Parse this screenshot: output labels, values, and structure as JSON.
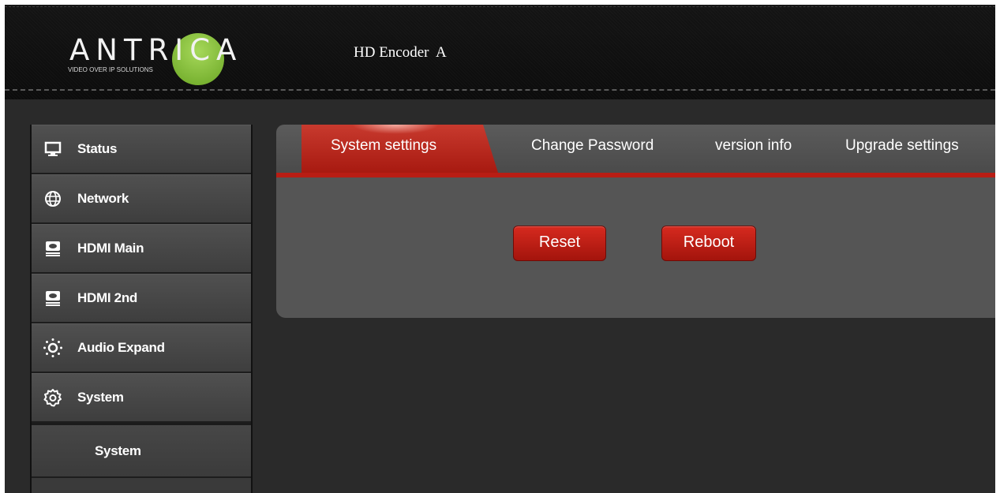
{
  "header": {
    "logo_text": "ANTRICA",
    "logo_tagline": "VIDEO OVER IP SOLUTIONS",
    "device_title": "HD Encoder  A"
  },
  "sidebar": {
    "items": [
      {
        "label": "Status",
        "icon": "monitor-icon"
      },
      {
        "label": "Network",
        "icon": "globe-icon"
      },
      {
        "label": "HDMI Main",
        "icon": "hdmi-icon"
      },
      {
        "label": "HDMI 2nd",
        "icon": "hdmi-icon"
      },
      {
        "label": "Audio Expand",
        "icon": "audio-dots-icon"
      },
      {
        "label": "System",
        "icon": "gear-icon"
      }
    ],
    "subitem": {
      "label": "System"
    }
  },
  "tabs": [
    {
      "label": "System settings",
      "active": true
    },
    {
      "label": "Change Password",
      "active": false
    },
    {
      "label": "version info",
      "active": false
    },
    {
      "label": "Upgrade settings",
      "active": false
    }
  ],
  "actions": {
    "reset_label": "Reset",
    "reboot_label": "Reboot"
  },
  "colors": {
    "accent_red": "#b81d14",
    "logo_green": "#8cc63f",
    "background": "#2a2a2a"
  }
}
